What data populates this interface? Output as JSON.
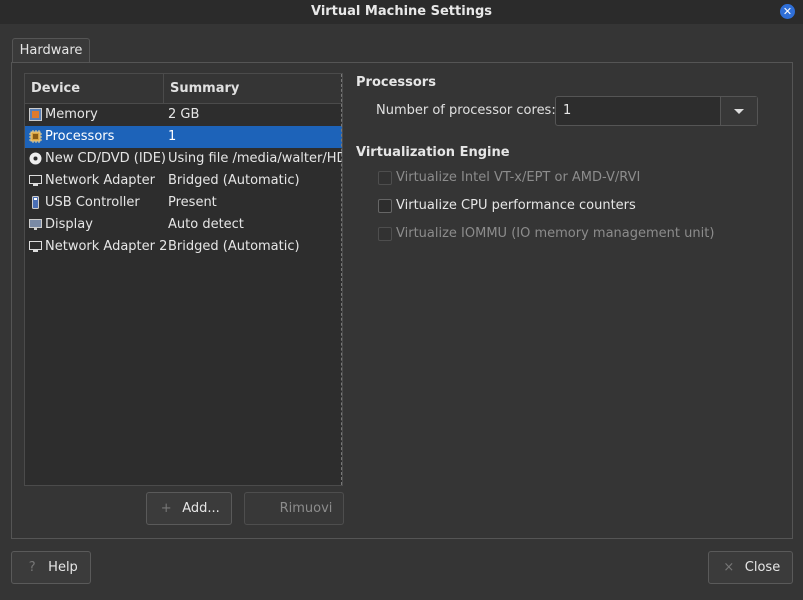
{
  "window": {
    "title": "Virtual Machine Settings",
    "close_glyph": "✕"
  },
  "tabs": [
    {
      "label": "Hardware"
    }
  ],
  "device_list": {
    "headers": {
      "device": "Device",
      "summary": "Summary"
    },
    "rows": [
      {
        "device": "Memory",
        "summary": "2 GB",
        "icon": "memory-icon",
        "selected": false
      },
      {
        "device": "Processors",
        "summary": "1",
        "icon": "processor-icon",
        "selected": true
      },
      {
        "device": "New CD/DVD (IDE)",
        "summary": "Using file /media/walter/HDD",
        "icon": "cd-dvd-icon",
        "selected": false
      },
      {
        "device": "Network Adapter",
        "summary": "Bridged (Automatic)",
        "icon": "network-adapter-icon",
        "selected": false
      },
      {
        "device": "USB Controller",
        "summary": "Present",
        "icon": "usb-icon",
        "selected": false
      },
      {
        "device": "Display",
        "summary": "Auto detect",
        "icon": "display-icon",
        "selected": false
      },
      {
        "device": "Network Adapter 2",
        "summary": "Bridged (Automatic)",
        "icon": "network-adapter-icon",
        "selected": false
      }
    ],
    "add_button": "Add...",
    "remove_button": "Rimuovi"
  },
  "processors": {
    "section_title": "Processors",
    "cores_label": "Number of processor cores:",
    "cores_value": "1"
  },
  "virtualization": {
    "section_title": "Virtualization Engine",
    "options": [
      {
        "label": "Virtualize Intel VT-x/EPT or AMD-V/RVI",
        "checked": false,
        "enabled": false
      },
      {
        "label": "Virtualize CPU performance counters",
        "checked": false,
        "enabled": true
      },
      {
        "label": "Virtualize IOMMU (IO memory management unit)",
        "checked": false,
        "enabled": false
      }
    ]
  },
  "footer": {
    "help_button": "Help",
    "close_button": "Close"
  },
  "colors": {
    "selection": "#1d63b9",
    "background": "#353535",
    "close_badge": "#2f6fd8"
  }
}
